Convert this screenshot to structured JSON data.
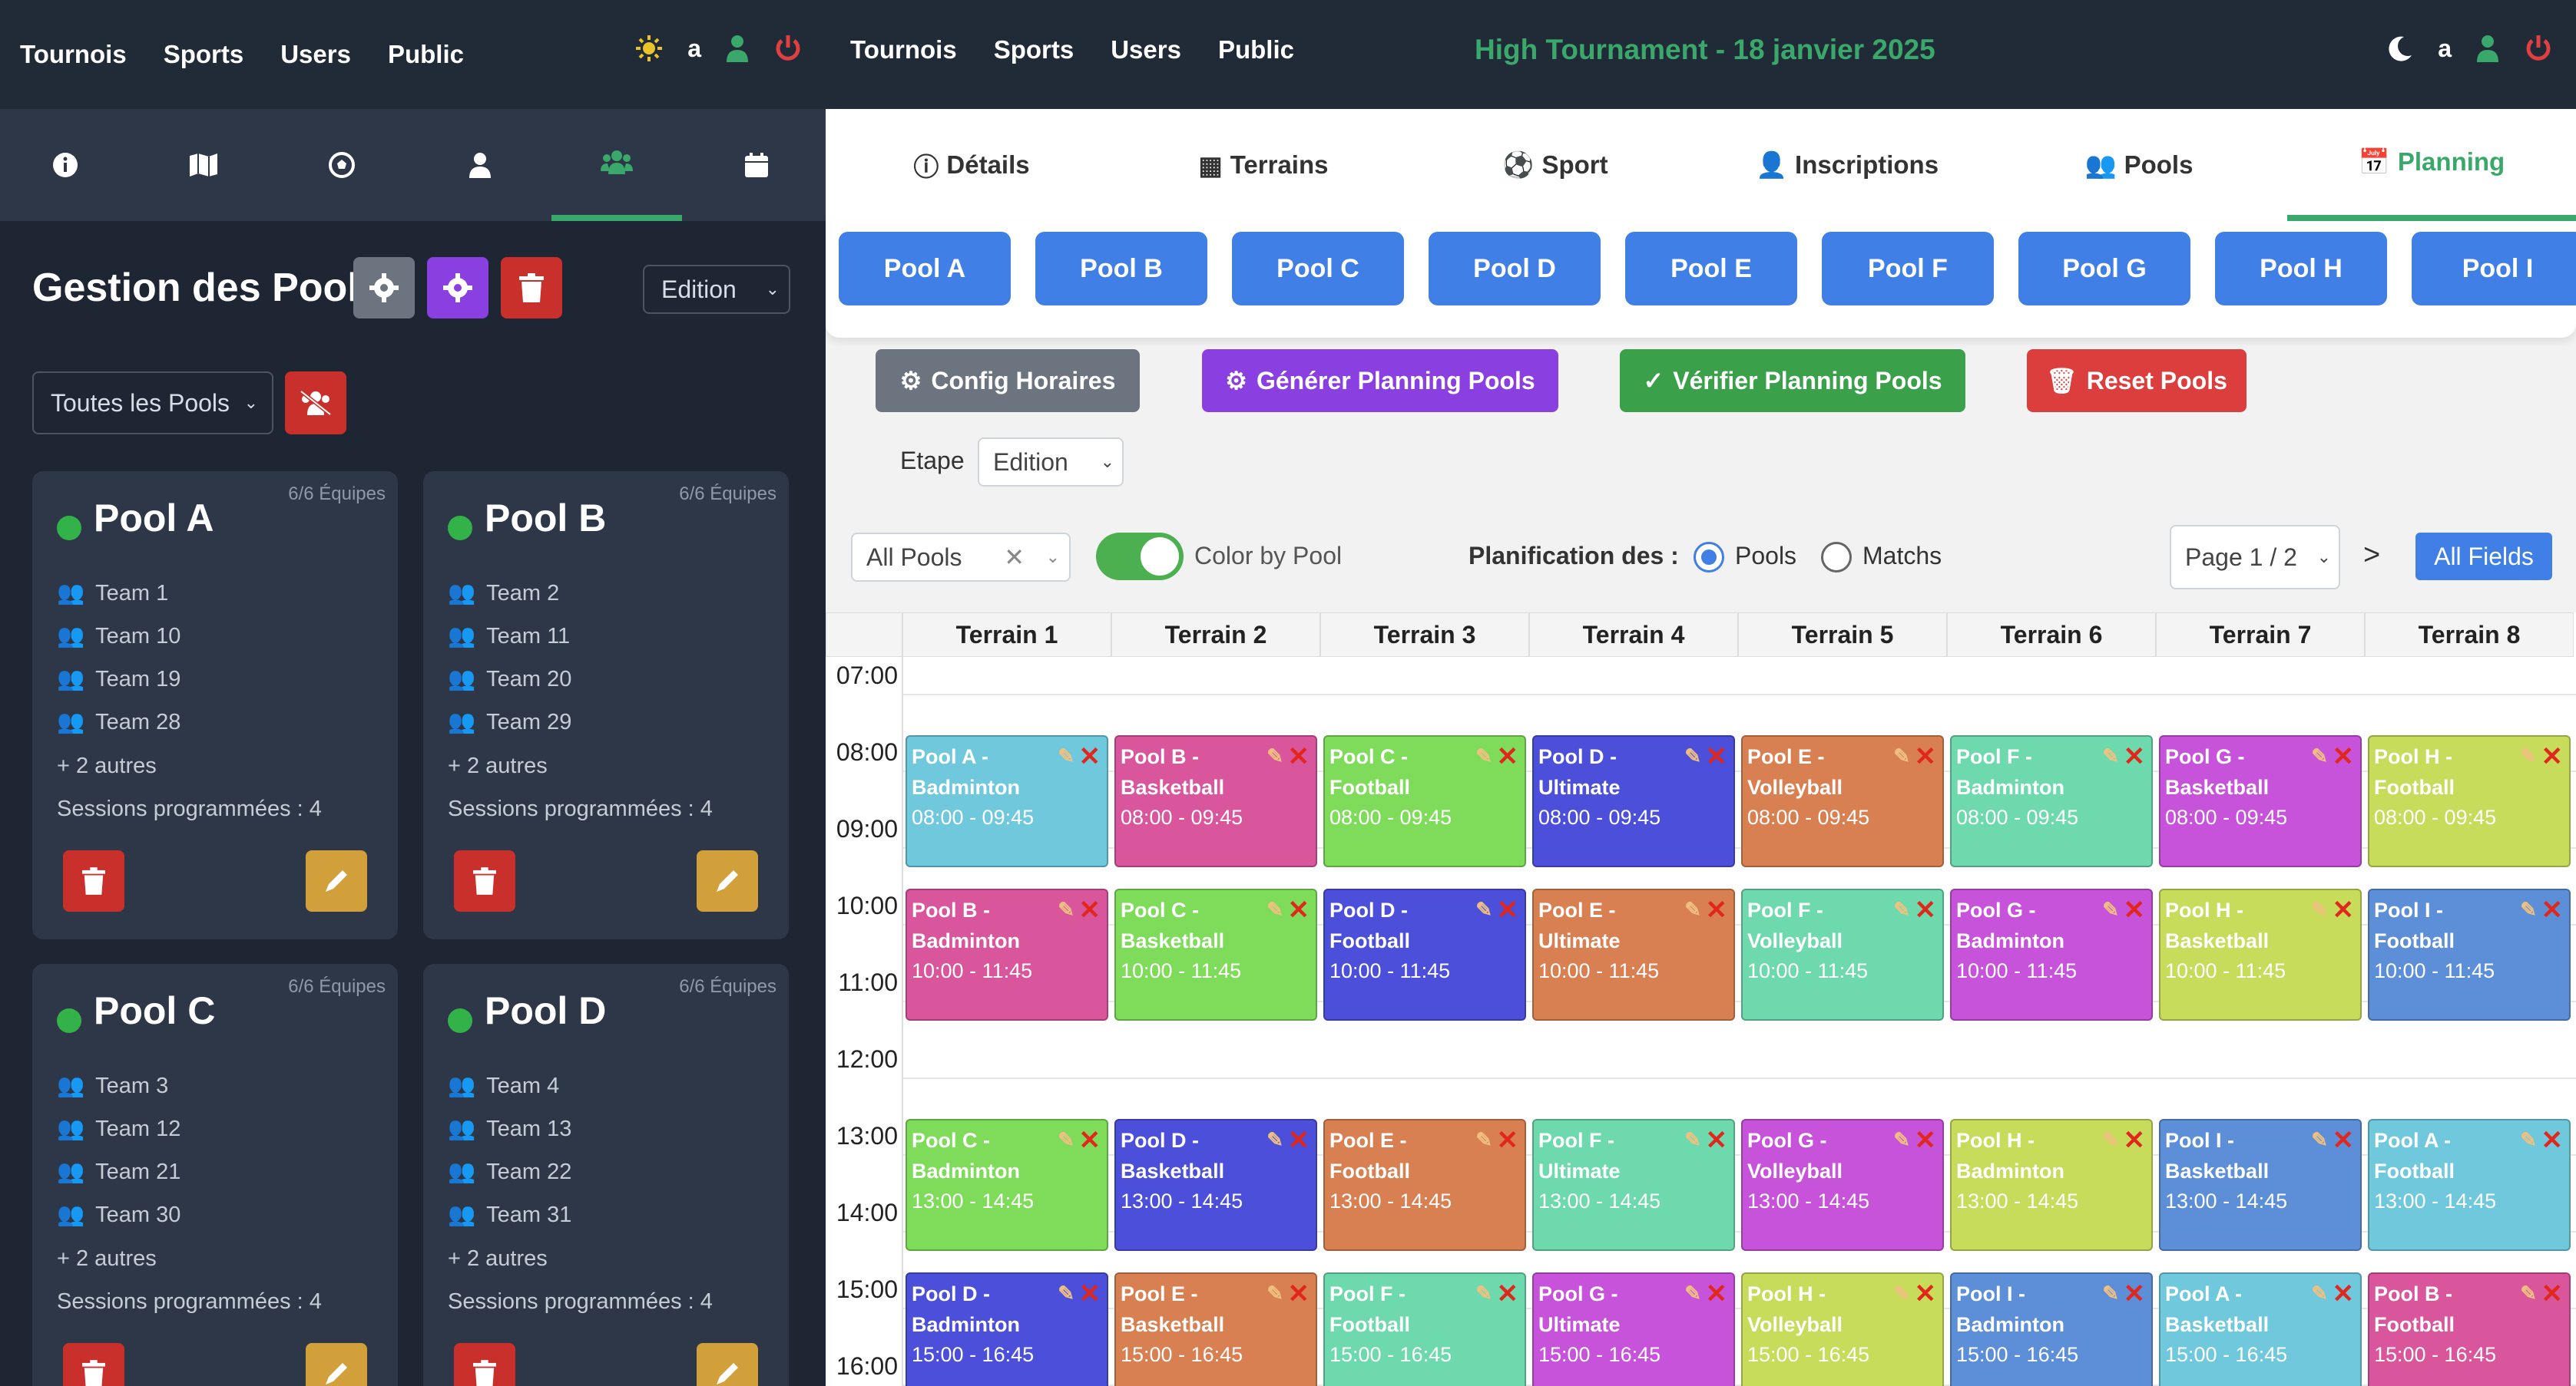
{
  "left": {
    "nav": [
      "Tournois",
      "Sports",
      "Users",
      "Public"
    ],
    "user_initial": "a",
    "title": "Gestion des Pools",
    "mode_select": "Edition",
    "filter_select": "Toutes les Pools",
    "tab_icons": [
      "info-icon",
      "map-icon",
      "soccer-ball-icon",
      "user-icon",
      "users-icon",
      "calendar-icon"
    ],
    "cards": [
      {
        "name": "Pool A",
        "equipes": "6/6 Équipes",
        "teams": [
          "Team 1",
          "Team 10",
          "Team 19",
          "Team 28"
        ],
        "more": "+ 2 autres",
        "sessions": "Sessions programmées : 4"
      },
      {
        "name": "Pool B",
        "equipes": "6/6 Équipes",
        "teams": [
          "Team 2",
          "Team 11",
          "Team 20",
          "Team 29"
        ],
        "more": "+ 2 autres",
        "sessions": "Sessions programmées : 4"
      },
      {
        "name": "Pool C",
        "equipes": "6/6 Équipes",
        "teams": [
          "Team 3",
          "Team 12",
          "Team 21",
          "Team 30"
        ],
        "more": "+ 2 autres",
        "sessions": "Sessions programmées : 4"
      },
      {
        "name": "Pool D",
        "equipes": "6/6 Équipes",
        "teams": [
          "Team 4",
          "Team 13",
          "Team 22",
          "Team 31"
        ],
        "more": "+ 2 autres",
        "sessions": "Sessions programmées : 4"
      }
    ]
  },
  "right": {
    "nav": [
      "Tournois",
      "Sports",
      "Users",
      "Public"
    ],
    "user_initial": "a",
    "title": "High Tournament - 18 janvier 2025",
    "tabs": [
      "Détails",
      "Terrains",
      "Sport",
      "Inscriptions",
      "Pools",
      "Planning"
    ],
    "pools": [
      "Pool A",
      "Pool B",
      "Pool C",
      "Pool D",
      "Pool E",
      "Pool F",
      "Pool G",
      "Pool H",
      "Pool I"
    ],
    "actions": {
      "config": "Config Horaires",
      "generate": "Générer Planning Pools",
      "verify": "Vérifier Planning Pools",
      "reset": "Reset Pools"
    },
    "etape_label": "Etape",
    "etape_value": "Edition",
    "pool_filter": "All Pools",
    "color_by_pool": "Color by Pool",
    "planif_label": "Planification des :",
    "radio_pools": "Pools",
    "radio_matchs": "Matchs",
    "page": "Page 1 / 2",
    "next": ">",
    "all_fields": "All Fields",
    "terrains": [
      "Terrain 1",
      "Terrain 2",
      "Terrain 3",
      "Terrain 4",
      "Terrain 5",
      "Terrain 6",
      "Terrain 7",
      "Terrain 8"
    ],
    "times": [
      "07:00",
      "08:00",
      "09:00",
      "10:00",
      "11:00",
      "12:00",
      "13:00",
      "14:00",
      "15:00",
      "16:00"
    ],
    "colors": {
      "A": "#6fc8dc",
      "B": "#d9559c",
      "C": "#7fdc5a",
      "D": "#4b4fd9",
      "E": "#d98052",
      "F": "#6dd9ad",
      "G": "#c653d9",
      "H": "#c6dc5a",
      "I": "#5d8fd9"
    },
    "rows": [
      {
        "slot": "08:00 - 09:45",
        "events": [
          [
            "A",
            "Badminton"
          ],
          [
            "B",
            "Basketball"
          ],
          [
            "C",
            "Football"
          ],
          [
            "D",
            "Ultimate"
          ],
          [
            "E",
            "Volleyball"
          ],
          [
            "F",
            "Badminton"
          ],
          [
            "G",
            "Basketball"
          ],
          [
            "H",
            "Football"
          ]
        ]
      },
      {
        "slot": "10:00 - 11:45",
        "events": [
          [
            "B",
            "Badminton"
          ],
          [
            "C",
            "Basketball"
          ],
          [
            "D",
            "Football"
          ],
          [
            "E",
            "Ultimate"
          ],
          [
            "F",
            "Volleyball"
          ],
          [
            "G",
            "Badminton"
          ],
          [
            "H",
            "Basketball"
          ],
          [
            "I",
            "Football"
          ]
        ]
      },
      {
        "slot": "13:00 - 14:45",
        "events": [
          [
            "C",
            "Badminton"
          ],
          [
            "D",
            "Basketball"
          ],
          [
            "E",
            "Football"
          ],
          [
            "F",
            "Ultimate"
          ],
          [
            "G",
            "Volleyball"
          ],
          [
            "H",
            "Badminton"
          ],
          [
            "I",
            "Basketball"
          ],
          [
            "A",
            "Football"
          ]
        ]
      },
      {
        "slot": "15:00 - 16:45",
        "events": [
          [
            "D",
            "Badminton"
          ],
          [
            "E",
            "Basketball"
          ],
          [
            "F",
            "Football"
          ],
          [
            "G",
            "Ultimate"
          ],
          [
            "H",
            "Volleyball"
          ],
          [
            "I",
            "Badminton"
          ],
          [
            "A",
            "Basketball"
          ],
          [
            "B",
            "Football"
          ]
        ]
      }
    ]
  }
}
